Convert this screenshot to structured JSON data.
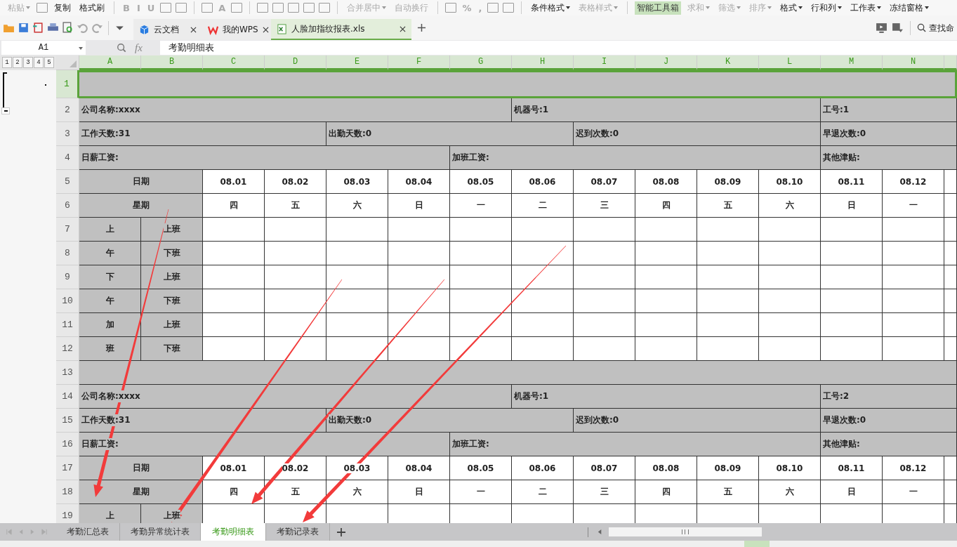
{
  "ribbon": [
    {
      "kind": "text",
      "label": "粘贴",
      "disabled": true,
      "dropdown": true,
      "highlighted": false
    },
    {
      "kind": "icon"
    },
    {
      "kind": "text",
      "label": "复制",
      "disabled": false,
      "dropdown": false,
      "highlighted": false
    },
    {
      "kind": "text",
      "label": "格式刷",
      "disabled": false,
      "dropdown": false,
      "highlighted": false
    },
    {
      "kind": "separator"
    },
    {
      "kind": "glyph",
      "label": "B",
      "disabled": true
    },
    {
      "kind": "glyph",
      "label": "I",
      "disabled": true
    },
    {
      "kind": "glyph",
      "label": "U",
      "disabled": true
    },
    {
      "kind": "icon"
    },
    {
      "kind": "icon"
    },
    {
      "kind": "separator"
    },
    {
      "kind": "icon"
    },
    {
      "kind": "glyph",
      "label": "A",
      "disabled": true
    },
    {
      "kind": "icon"
    },
    {
      "kind": "separator"
    },
    {
      "kind": "icon"
    },
    {
      "kind": "icon"
    },
    {
      "kind": "icon"
    },
    {
      "kind": "icon"
    },
    {
      "kind": "icon"
    },
    {
      "kind": "separator"
    },
    {
      "kind": "text",
      "label": "合并居中",
      "disabled": true,
      "dropdown": true,
      "highlighted": false
    },
    {
      "kind": "text",
      "label": "自动换行",
      "disabled": true,
      "dropdown": false,
      "highlighted": false
    },
    {
      "kind": "separator"
    },
    {
      "kind": "icon"
    },
    {
      "kind": "glyph",
      "label": "%",
      "disabled": true
    },
    {
      "kind": "glyph",
      "label": ",",
      "disabled": true
    },
    {
      "kind": "icon"
    },
    {
      "kind": "icon"
    },
    {
      "kind": "separator"
    },
    {
      "kind": "text",
      "label": "条件格式",
      "disabled": false,
      "dropdown": true,
      "highlighted": false
    },
    {
      "kind": "text",
      "label": "表格样式",
      "disabled": true,
      "dropdown": true,
      "highlighted": false
    },
    {
      "kind": "separator"
    },
    {
      "kind": "text",
      "label": "智能工具箱",
      "disabled": false,
      "dropdown": false,
      "highlighted": true
    },
    {
      "kind": "text",
      "label": "求和",
      "disabled": true,
      "dropdown": true,
      "highlighted": false
    },
    {
      "kind": "text",
      "label": "筛选",
      "disabled": true,
      "dropdown": true,
      "highlighted": false
    },
    {
      "kind": "text",
      "label": "排序",
      "disabled": true,
      "dropdown": true,
      "highlighted": false
    },
    {
      "kind": "text",
      "label": "格式",
      "disabled": false,
      "dropdown": true,
      "highlighted": false
    },
    {
      "kind": "text",
      "label": "行和列",
      "disabled": false,
      "dropdown": true,
      "highlighted": false
    },
    {
      "kind": "text",
      "label": "工作表",
      "disabled": false,
      "dropdown": true,
      "highlighted": false
    },
    {
      "kind": "text",
      "label": "冻结窗格",
      "disabled": false,
      "dropdown": true,
      "highlighted": false
    }
  ],
  "doc_tabs": [
    {
      "label": "云文档",
      "kind": "cloud",
      "selected": false
    },
    {
      "label": "我的WPS",
      "kind": "wps",
      "selected": false
    },
    {
      "label": "人脸加指纹报表.xls",
      "kind": "sheet",
      "selected": true
    }
  ],
  "command_search": {
    "placeholder": "查找命"
  },
  "formula_bar": {
    "cell": "A1",
    "fx": "fx",
    "value": "考勤明细表"
  },
  "outline_levels": [
    "1",
    "2",
    "3",
    "4",
    "5"
  ],
  "columns": [
    {
      "label": "A",
      "selected": true
    },
    {
      "label": "B",
      "selected": true
    },
    {
      "label": "C",
      "selected": true
    },
    {
      "label": "D",
      "selected": true
    },
    {
      "label": "E",
      "selected": true
    },
    {
      "label": "F",
      "selected": true
    },
    {
      "label": "G",
      "selected": true
    },
    {
      "label": "H",
      "selected": true
    },
    {
      "label": "I",
      "selected": true
    },
    {
      "label": "J",
      "selected": true
    },
    {
      "label": "K",
      "selected": true
    },
    {
      "label": "L",
      "selected": true
    },
    {
      "label": "M",
      "selected": true
    },
    {
      "label": "N",
      "selected": true
    }
  ],
  "rows": [
    {
      "number": "1",
      "kind": "banner",
      "selected": true,
      "cells": []
    },
    {
      "number": "2",
      "kind": "info3",
      "selected": false,
      "cells": [
        "公司名称:xxxx",
        "机器号:1",
        "工号:1"
      ]
    },
    {
      "number": "3",
      "kind": "info4",
      "selected": false,
      "cells": [
        "工作天数:31",
        "出勤天数:0",
        "迟到次数:0",
        "早退次数:0"
      ]
    },
    {
      "number": "4",
      "kind": "info3b",
      "selected": false,
      "cells": [
        "日薪工资:",
        "加班工资:",
        "其他津贴:"
      ]
    },
    {
      "number": "5",
      "kind": "dates",
      "selected": false,
      "cells": [
        "日期",
        "08.01",
        "08.02",
        "08.03",
        "08.04",
        "08.05",
        "08.06",
        "08.07",
        "08.08",
        "08.09",
        "08.10",
        "08.11",
        "08.12"
      ]
    },
    {
      "number": "6",
      "kind": "dates",
      "selected": false,
      "cells": [
        "星期",
        "四",
        "五",
        "六",
        "日",
        "一",
        "二",
        "三",
        "四",
        "五",
        "六",
        "日",
        "一"
      ]
    },
    {
      "number": "7",
      "kind": "slot",
      "selected": false,
      "cells": [
        "上",
        "上班"
      ]
    },
    {
      "number": "8",
      "kind": "slot",
      "selected": false,
      "cells": [
        "午",
        "下班"
      ]
    },
    {
      "number": "9",
      "kind": "slot",
      "selected": false,
      "cells": [
        "下",
        "上班"
      ]
    },
    {
      "number": "10",
      "kind": "slot",
      "selected": false,
      "cells": [
        "午",
        "下班"
      ]
    },
    {
      "number": "11",
      "kind": "slot",
      "selected": false,
      "cells": [
        "加",
        "上班"
      ]
    },
    {
      "number": "12",
      "kind": "slot",
      "selected": false,
      "cells": [
        "班",
        "下班"
      ]
    },
    {
      "number": "13",
      "kind": "banner",
      "selected": false,
      "cells": []
    },
    {
      "number": "14",
      "kind": "info3",
      "selected": false,
      "cells": [
        "公司名称:xxxx",
        "机器号:1",
        "工号:2"
      ]
    },
    {
      "number": "15",
      "kind": "info4",
      "selected": false,
      "cells": [
        "工作天数:31",
        "出勤天数:0",
        "迟到次数:0",
        "早退次数:0"
      ]
    },
    {
      "number": "16",
      "kind": "info3b",
      "selected": false,
      "cells": [
        "日薪工资:",
        "加班工资:",
        "其他津贴:"
      ]
    },
    {
      "number": "17",
      "kind": "dates",
      "selected": false,
      "cells": [
        "日期",
        "08.01",
        "08.02",
        "08.03",
        "08.04",
        "08.05",
        "08.06",
        "08.07",
        "08.08",
        "08.09",
        "08.10",
        "08.11",
        "08.12"
      ]
    },
    {
      "number": "18",
      "kind": "dates",
      "selected": false,
      "cells": [
        "星期",
        "四",
        "五",
        "六",
        "日",
        "一",
        "二",
        "三",
        "四",
        "五",
        "六",
        "日",
        "一"
      ]
    },
    {
      "number": "19",
      "kind": "slot",
      "selected": false,
      "cells": [
        "上",
        "上班"
      ]
    }
  ],
  "sheet_tabs": [
    {
      "label": "考勤汇总表",
      "selected": false
    },
    {
      "label": "考勤异常统计表",
      "selected": false
    },
    {
      "label": "考勤明细表",
      "selected": true
    },
    {
      "label": "考勤记录表",
      "selected": false
    }
  ]
}
